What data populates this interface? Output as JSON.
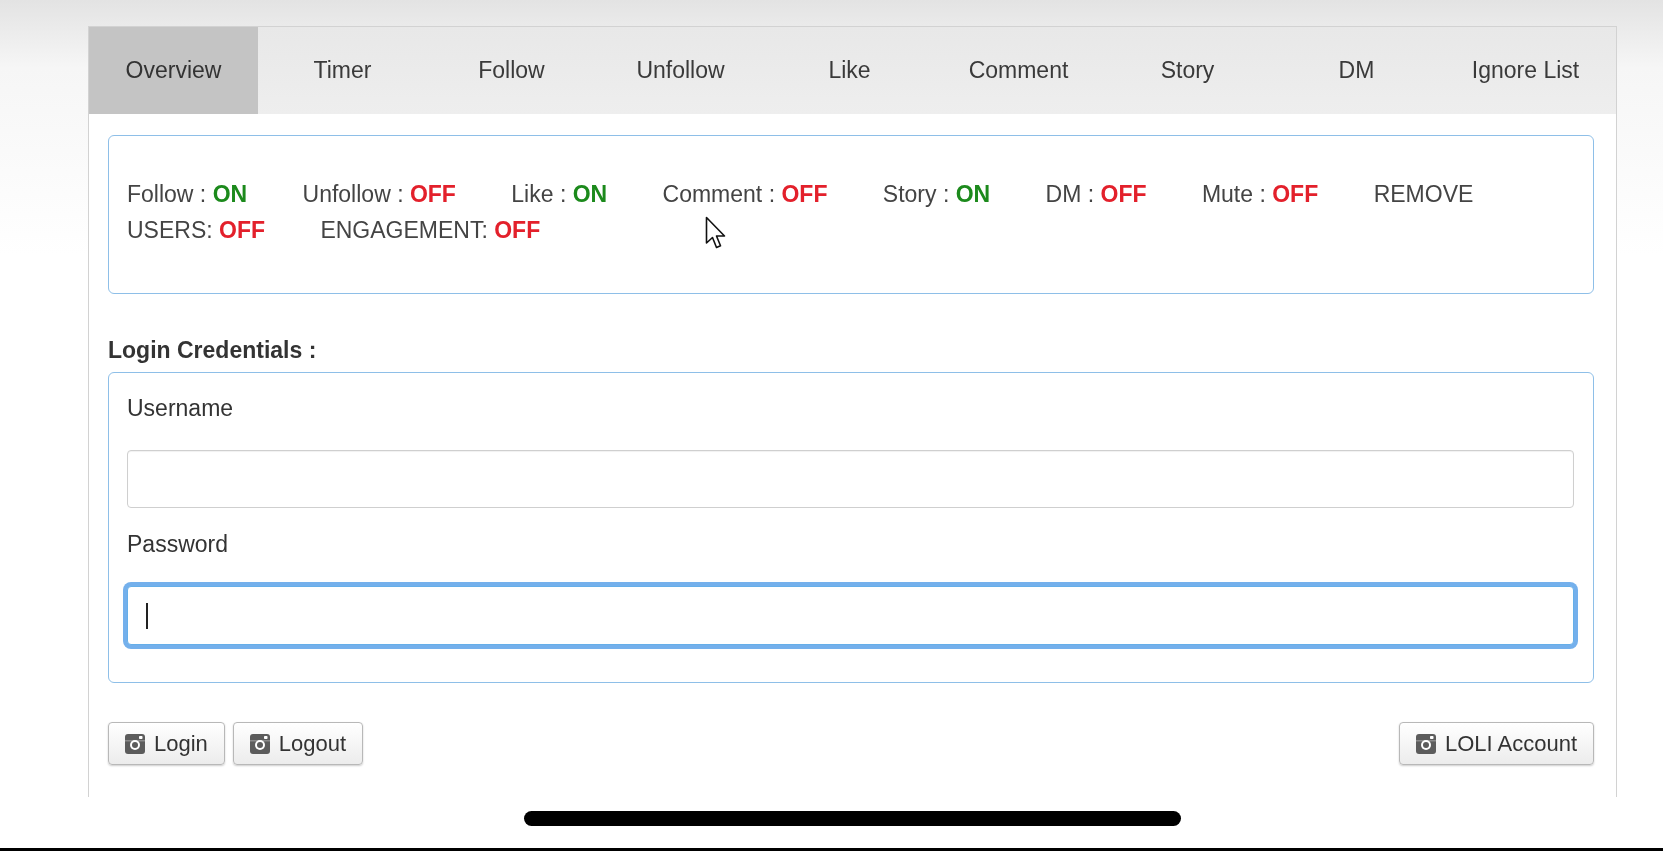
{
  "tabs": [
    {
      "label": "Overview",
      "selected": true
    },
    {
      "label": "Timer",
      "selected": false
    },
    {
      "label": "Follow",
      "selected": false
    },
    {
      "label": "Unfollow",
      "selected": false
    },
    {
      "label": "Like",
      "selected": false
    },
    {
      "label": "Comment",
      "selected": false
    },
    {
      "label": "Story",
      "selected": false
    },
    {
      "label": "DM",
      "selected": false
    },
    {
      "label": "Ignore List",
      "selected": false
    }
  ],
  "status": {
    "items": [
      {
        "label": "Follow :",
        "value": "ON",
        "on": true
      },
      {
        "label": "Unfollow :",
        "value": "OFF",
        "on": false
      },
      {
        "label": "Like :",
        "value": "ON",
        "on": true
      },
      {
        "label": "Comment :",
        "value": "OFF",
        "on": false
      },
      {
        "label": "Story :",
        "value": "ON",
        "on": true
      },
      {
        "label": "DM :",
        "value": "OFF",
        "on": false
      },
      {
        "label": "Mute :",
        "value": "OFF",
        "on": false
      },
      {
        "label": "REMOVE USERS:",
        "value": "OFF",
        "on": false
      },
      {
        "label": "ENGAGEMENT:",
        "value": "OFF",
        "on": false
      }
    ]
  },
  "login": {
    "title": "Login Credentials :",
    "fields": [
      {
        "label": "Username",
        "focused": false
      },
      {
        "label": "Password",
        "focused": true
      }
    ]
  },
  "buttons": {
    "left": [
      "Login",
      "Logout"
    ],
    "right": [
      "LOLI Account"
    ]
  }
}
